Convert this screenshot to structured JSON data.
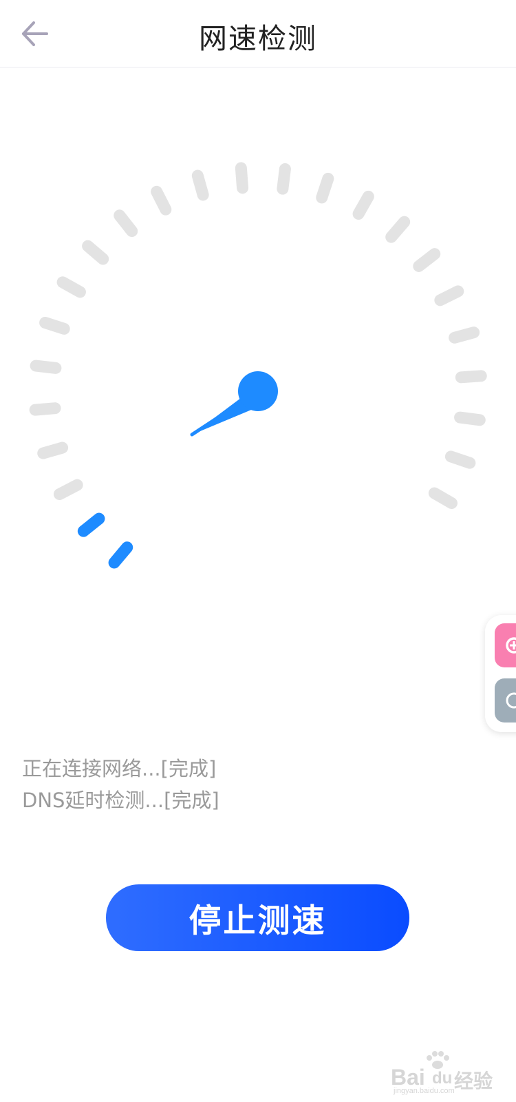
{
  "header": {
    "title": "网速检测",
    "back_icon": "arrow-left-icon"
  },
  "gauge": {
    "tick_count": 24,
    "active_ticks": 2,
    "needle_color": "#1e8bff",
    "active_color": "#1e8bff",
    "inactive_color": "#e3e3e3"
  },
  "status": {
    "lines": [
      "正在连接网络...[完成]",
      "DNS延时检测...[完成]"
    ]
  },
  "actions": {
    "stop_label": "停止测速"
  },
  "float": {
    "top_icon": "plus-icon",
    "bottom_icon": "refresh-icon"
  },
  "watermark": {
    "brand": "Bai",
    "brand_suffix": "经验",
    "url": "jingyan.baidu.com"
  }
}
